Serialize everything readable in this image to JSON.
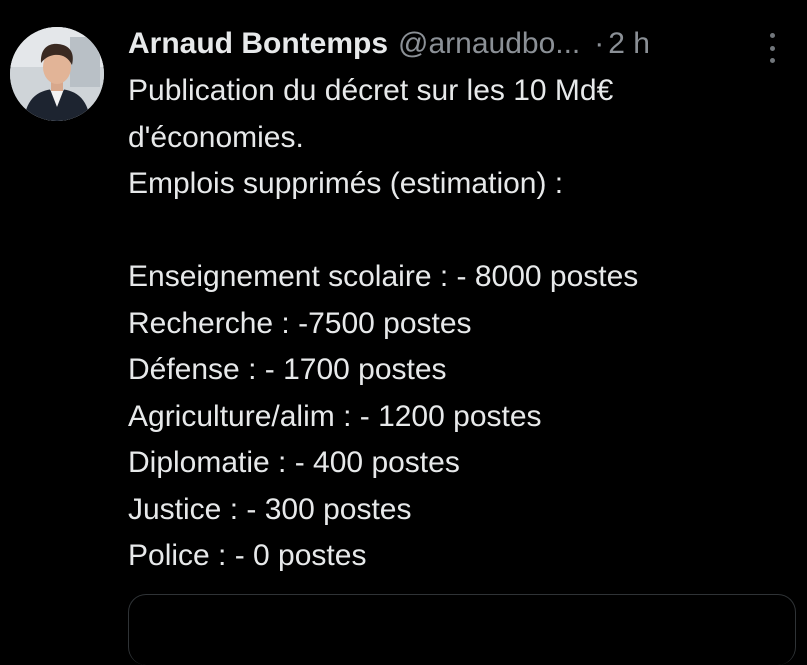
{
  "tweet": {
    "author_name": "Arnaud Bontemps",
    "handle": "@arnaudbo...",
    "separator": "·",
    "time": "2 h",
    "avatar_icon": "user-avatar-photo",
    "more_icon": "more-options-icon",
    "lines": [
      "Publication du décret sur les 10 Md€",
      "d'économies.",
      "Emplois supprimés (estimation) :",
      "",
      "Enseignement scolaire : - 8000 postes",
      "Recherche : -7500 postes",
      "Défense : - 1700 postes",
      "Agriculture/alim : - 1200 postes",
      "Diplomatie : - 400 postes",
      "Justice : - 300 postes",
      "Police : - 0 postes"
    ]
  },
  "colors": {
    "background": "#000000",
    "primary_text": "#e7e9ea",
    "secondary_text": "#8b9096",
    "border": "#2f3336"
  }
}
